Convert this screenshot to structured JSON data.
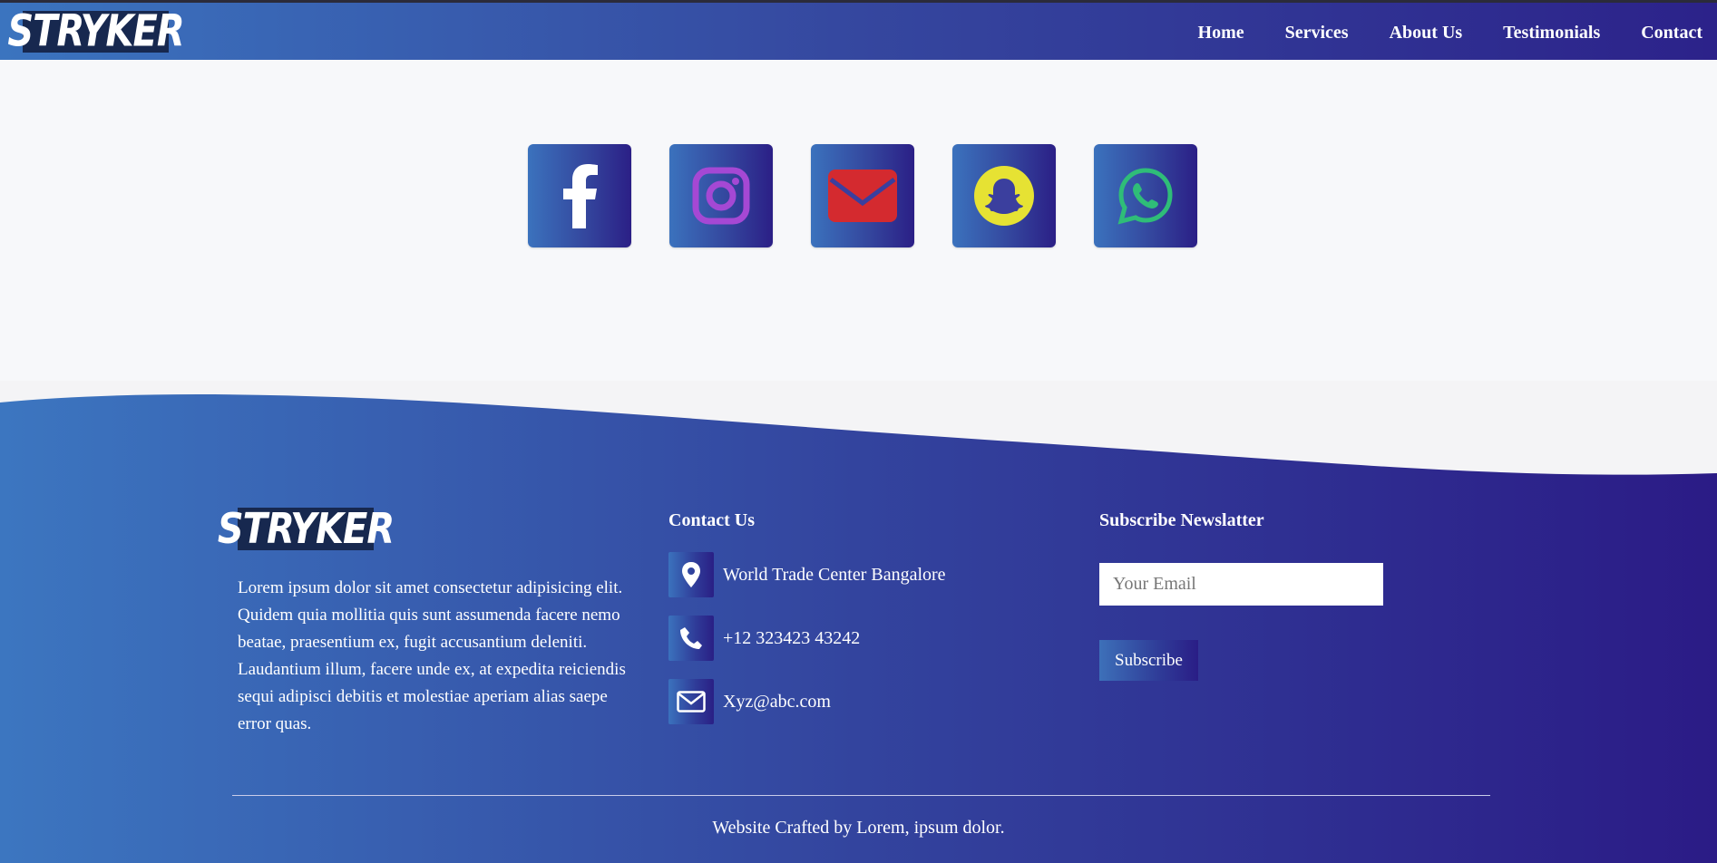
{
  "brand": {
    "logo_text": "STRYKER"
  },
  "nav": {
    "items": [
      {
        "label": "Home"
      },
      {
        "label": "Services"
      },
      {
        "label": "About Us"
      },
      {
        "label": "Testimonials"
      },
      {
        "label": "Contact"
      }
    ]
  },
  "social": {
    "items": [
      {
        "icon": "facebook-icon"
      },
      {
        "icon": "instagram-icon"
      },
      {
        "icon": "mail-icon"
      },
      {
        "icon": "snapchat-icon"
      },
      {
        "icon": "whatsapp-icon"
      }
    ]
  },
  "footer": {
    "logo_text": "STRYKER",
    "about": "Lorem ipsum dolor sit amet consectetur adipisicing elit. Quidem quia mollitia quis sunt assumenda facere nemo beatae, praesentium ex, fugit accusantium deleniti. Laudantium illum, facere unde ex, at expedita reiciendis sequi adipisci debitis et molestiae aperiam alias saepe error quas.",
    "contact": {
      "title": "Contact Us",
      "address": "World Trade Center Bangalore",
      "phone": "+12 323423 43242",
      "email": "Xyz@abc.com"
    },
    "newsletter": {
      "title": "Subscribe Newslatter",
      "placeholder": "Your Email",
      "button": "Subscribe"
    },
    "credit": "Website Crafted by Lorem, ipsum dolor."
  },
  "colors": {
    "gradient_start": "#3b74bf",
    "gradient_end": "#2c1f86",
    "logo_bg": "#17284f",
    "page_bg": "#f7f8fa"
  }
}
